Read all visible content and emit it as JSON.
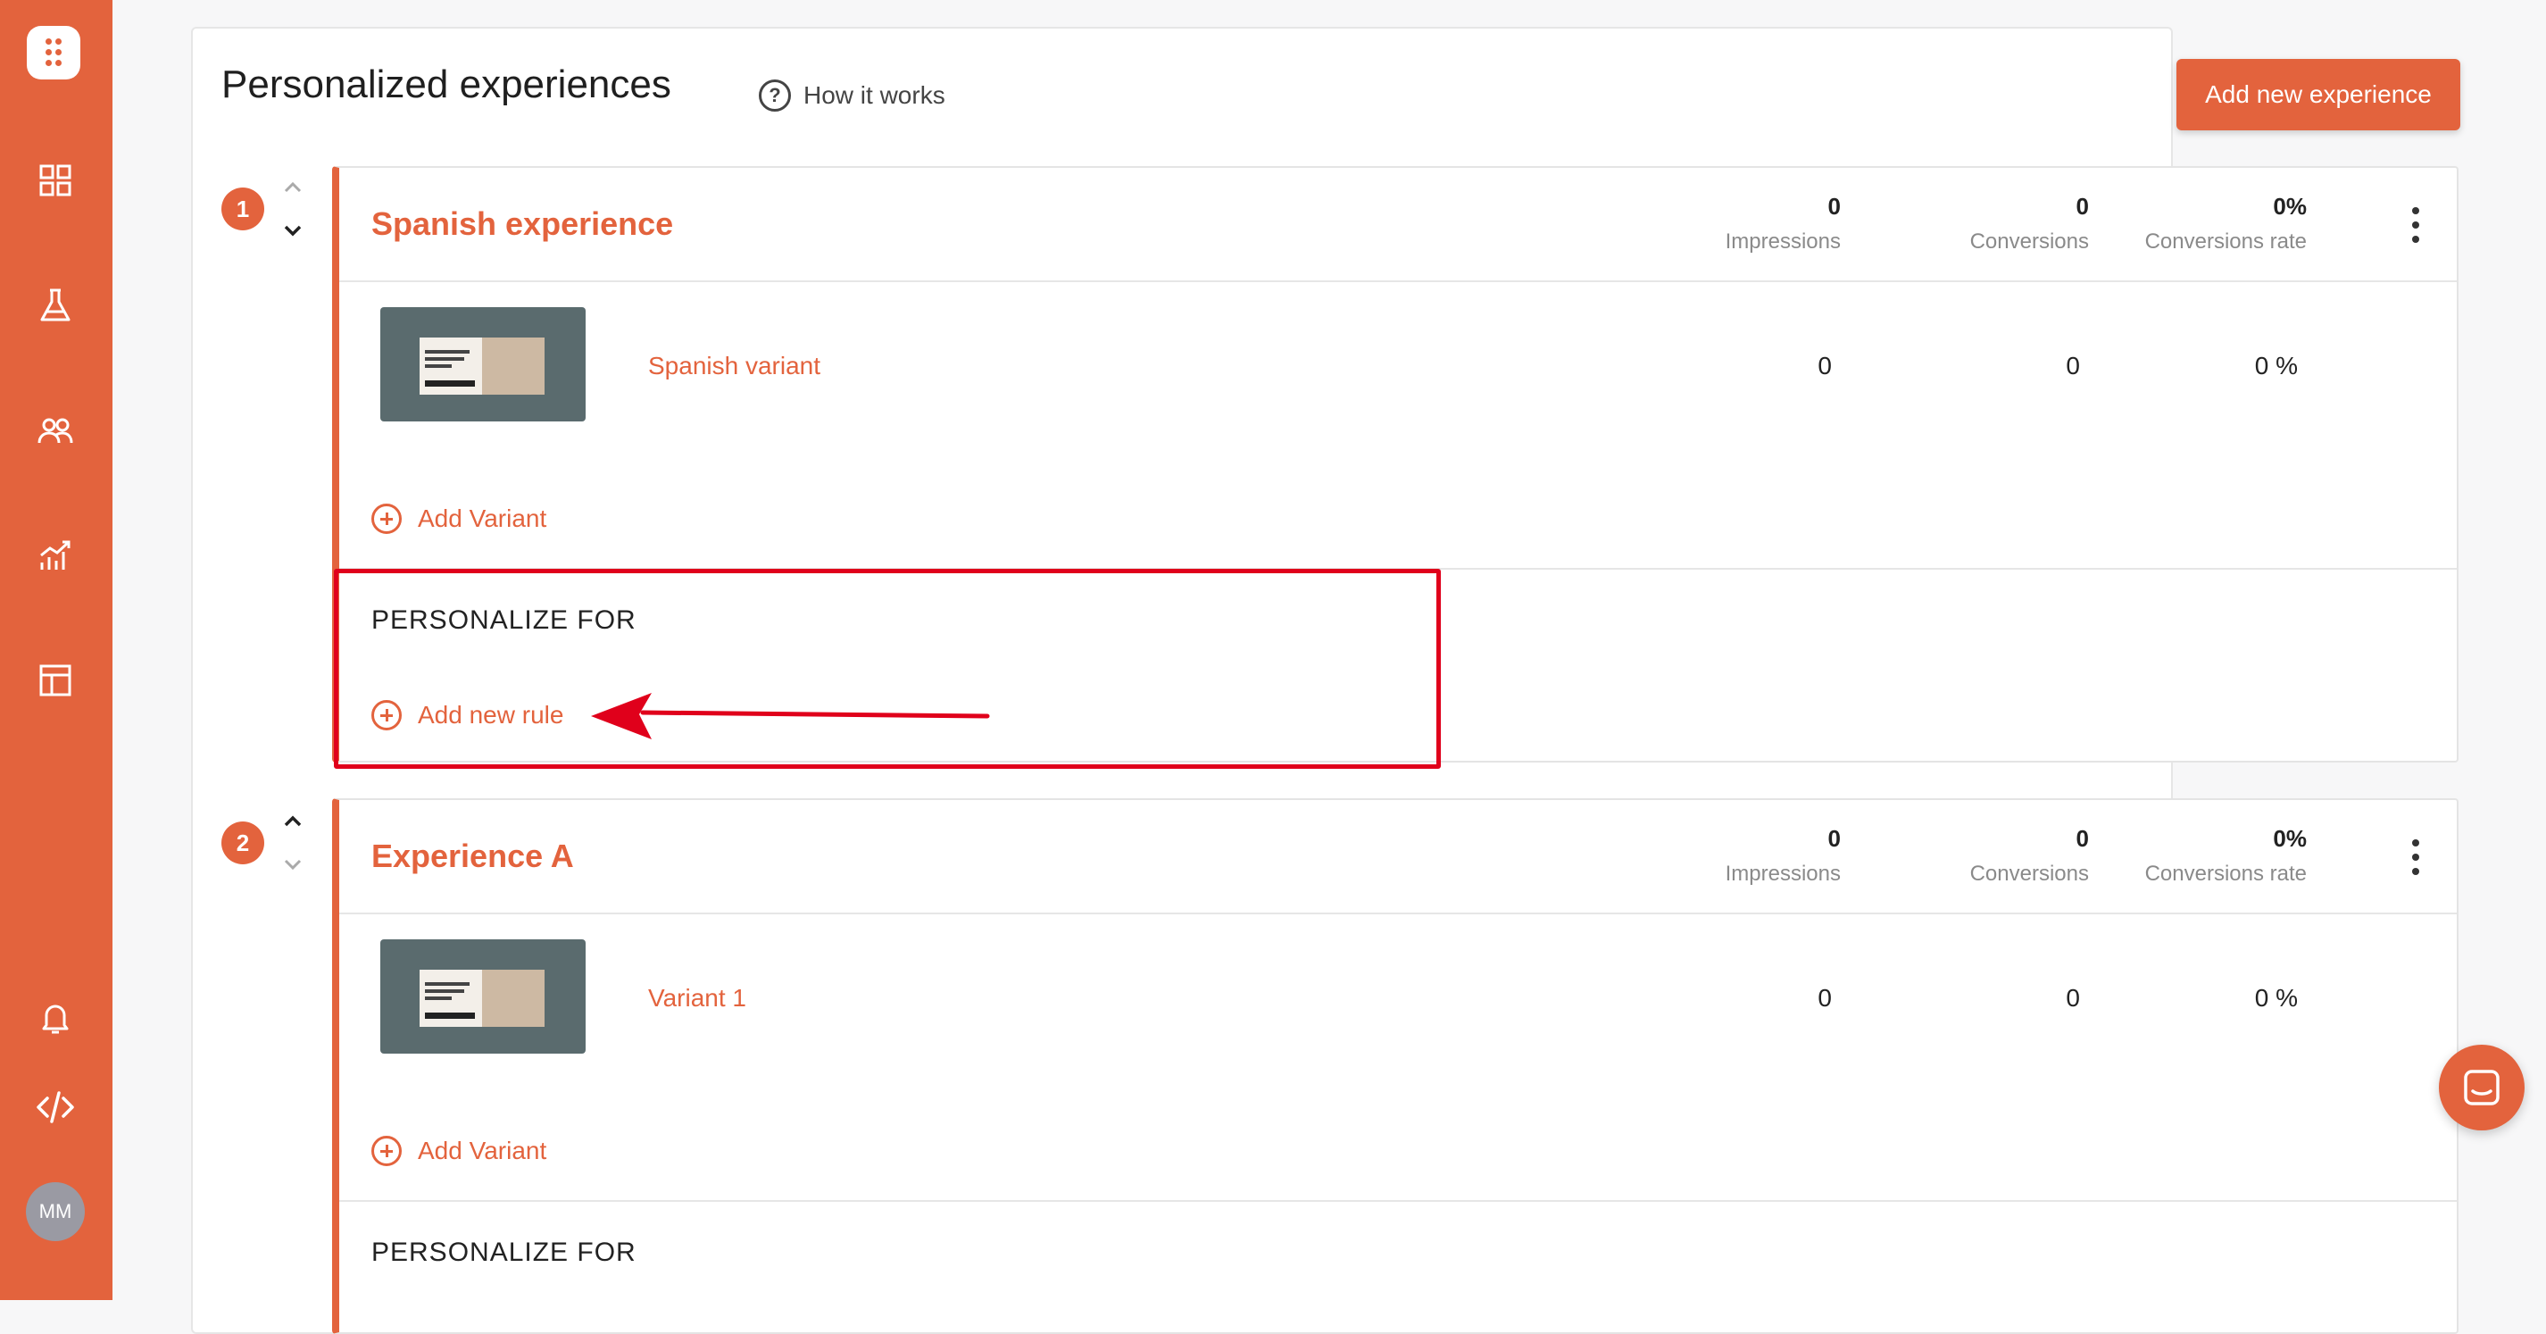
{
  "sidebar": {
    "nav": [
      {
        "name": "dashboard-icon"
      },
      {
        "name": "flask-icon"
      },
      {
        "name": "users-icon"
      },
      {
        "name": "analytics-icon"
      },
      {
        "name": "layout-icon"
      }
    ],
    "bottom": [
      {
        "name": "bell-icon"
      },
      {
        "name": "code-icon"
      }
    ],
    "avatar_initials": "MM",
    "accent_color": "#e3633d"
  },
  "header": {
    "title": "Personalized experiences",
    "how_it_works": "How it works",
    "add_experience_label": "Add new experience"
  },
  "experiences": [
    {
      "rank": "1",
      "title": "Spanish experience",
      "metrics": {
        "impressions": "0",
        "impressions_label": "Impressions",
        "conversions": "0",
        "conversions_label": "Conversions",
        "rate": "0%",
        "rate_label": "Conversions rate"
      },
      "variant": {
        "name": "Spanish variant",
        "impressions": "0",
        "conversions": "0",
        "rate": "0 %"
      },
      "add_variant_label": "Add Variant",
      "personalize_for": "PERSONALIZE FOR",
      "add_rule_label": "Add new rule"
    },
    {
      "rank": "2",
      "title": "Experience A",
      "metrics": {
        "impressions": "0",
        "impressions_label": "Impressions",
        "conversions": "0",
        "conversions_label": "Conversions",
        "rate": "0%",
        "rate_label": "Conversions rate"
      },
      "variant": {
        "name": "Variant 1",
        "impressions": "0",
        "conversions": "0",
        "rate": "0 %"
      },
      "add_variant_label": "Add Variant",
      "personalize_for": "PERSONALIZE FOR"
    }
  ],
  "annotation_color": "#e0001b"
}
